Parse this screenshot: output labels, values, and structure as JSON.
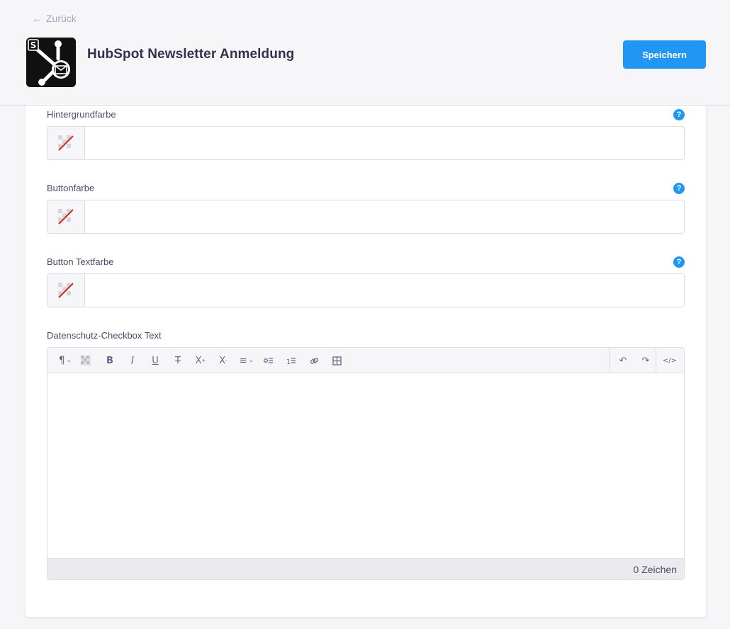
{
  "header": {
    "back_label": "Zurück",
    "title": "HubSpot Newsletter Anmeldung",
    "save_label": "Speichern"
  },
  "fields": {
    "background_color": {
      "label": "Hintergrundfarbe",
      "value": ""
    },
    "button_color": {
      "label": "Buttonfarbe",
      "value": ""
    },
    "button_text_color": {
      "label": "Button Textfarbe",
      "value": ""
    },
    "privacy_text": {
      "label": "Datenschutz-Checkbox Text",
      "value": "",
      "char_count": "0 Zeichen"
    }
  },
  "help_glyph": "?",
  "colors": {
    "accent": "#2196f3",
    "empty_swatch_slash": "#d02b20"
  },
  "toolbar_icons": [
    "paragraph-icon",
    "color-icon",
    "bold-icon",
    "italic-icon",
    "underline-icon",
    "strikethrough-icon",
    "superscript-icon",
    "subscript-icon",
    "align-icon",
    "bullet-list-icon",
    "numbered-list-icon",
    "link-icon",
    "table-icon",
    "undo-icon",
    "redo-icon",
    "source-code-icon"
  ]
}
